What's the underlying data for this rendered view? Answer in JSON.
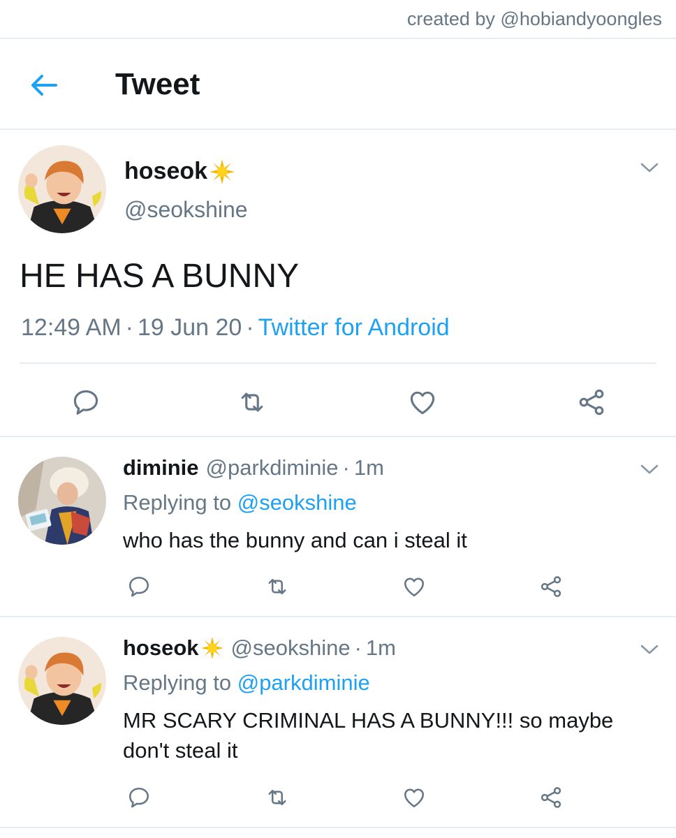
{
  "credit": "created by @hobiandyoongles",
  "header": {
    "title": "Tweet",
    "back_icon": "arrow-left-icon",
    "accent": "#1da1f2"
  },
  "main_tweet": {
    "name": "hoseok",
    "name_emoji": "sun-emoji",
    "handle": "@seokshine",
    "text": "HE HAS A BUNNY",
    "time": "12:49 AM",
    "date": "19 Jun 20",
    "source": "Twitter for Android",
    "separator": "·"
  },
  "replies": [
    {
      "name": "diminie",
      "handle": "@parkdiminie",
      "time": "1m",
      "replying_prefix": "Replying to",
      "replying_to": "@seokshine",
      "text": "who has the bunny and can i steal it"
    },
    {
      "name": "hoseok",
      "name_emoji": "sun-emoji",
      "handle": "@seokshine",
      "time": "1m",
      "replying_prefix": "Replying to",
      "replying_to": "@parkdiminie",
      "text": "MR SCARY CRIMINAL HAS A BUNNY!!! so maybe don't steal it"
    }
  ],
  "actions": [
    "reply-icon",
    "retweet-icon",
    "like-icon",
    "share-icon"
  ],
  "colors": {
    "muted": "#657786",
    "link": "#1da1f2",
    "divider": "#e6ecf0",
    "text": "#14171a"
  }
}
